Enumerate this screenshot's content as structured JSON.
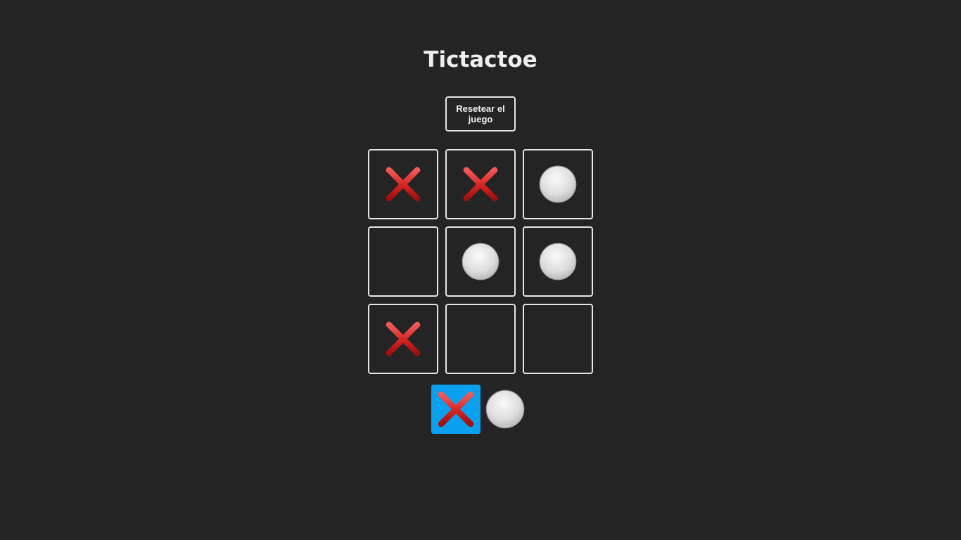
{
  "title": "Tictactoe",
  "reset_label": "Resetear el juego",
  "board": [
    "x",
    "x",
    "o",
    "",
    "o",
    "o",
    "x",
    "",
    ""
  ],
  "turn": {
    "players": [
      "x",
      "o"
    ],
    "current": "x"
  },
  "colors": {
    "background": "#242424",
    "border": "#e6e6e6",
    "active_turn": "#0aa0f0",
    "x_mark": "#d42424",
    "o_mark": "#dedede"
  },
  "icons": {
    "x": "cross-mark-icon",
    "o": "white-circle-icon"
  }
}
